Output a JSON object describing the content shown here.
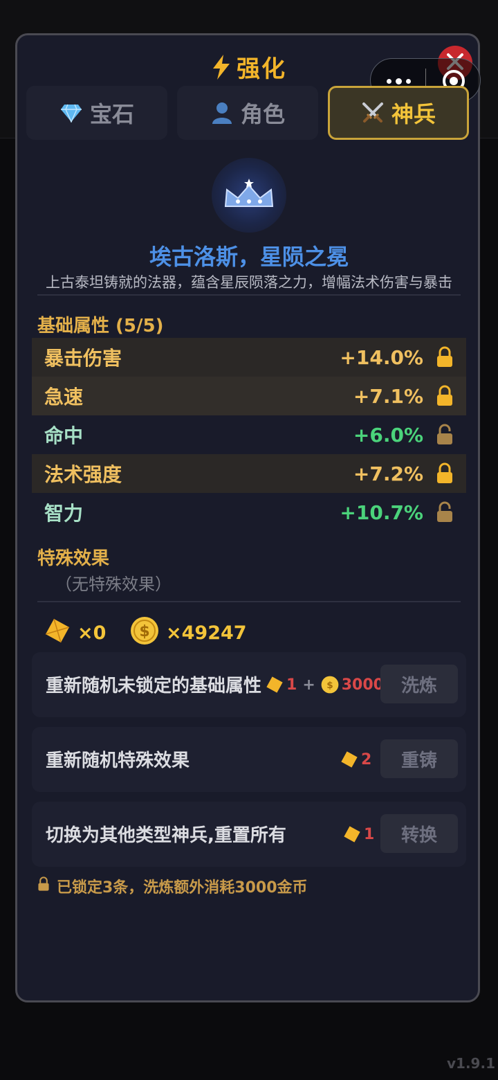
{
  "title": "强化",
  "tabs": [
    {
      "label": "宝石",
      "icon": "gem-icon",
      "active": false
    },
    {
      "label": "角色",
      "icon": "person-icon",
      "active": false
    },
    {
      "label": "神兵",
      "icon": "crossed-swords-icon",
      "active": true
    }
  ],
  "item": {
    "name": "埃古洛斯，星陨之冕",
    "description": "上古泰坦铸就的法器，蕴含星辰陨落之力，增幅法术伤害与暴击",
    "icon": "crown-icon"
  },
  "base_attributes": {
    "heading": "基础属性 (5/5)",
    "rows": [
      {
        "name": "暴击伤害",
        "value": "+14.0%",
        "locked": true
      },
      {
        "name": "急速",
        "value": "+7.1%",
        "locked": true
      },
      {
        "name": "命中",
        "value": "+6.0%",
        "locked": false
      },
      {
        "name": "法术强度",
        "value": "+7.2%",
        "locked": true
      },
      {
        "name": "智力",
        "value": "+10.7%",
        "locked": false
      }
    ]
  },
  "special": {
    "heading": "特殊效果",
    "empty_text": "（无特殊效果）"
  },
  "currency": {
    "shards": "×0",
    "gold": "×49247"
  },
  "actions": [
    {
      "label": "重新随机未锁定的基础属性",
      "cost_shards": "1",
      "cost_gold": "3000",
      "button": "洗炼"
    },
    {
      "label": "重新随机特殊效果",
      "cost_shards": "2",
      "button": "重铸"
    },
    {
      "label": "切换为其他类型神兵,重置所有",
      "cost_shards": "1",
      "button": "转换"
    }
  ],
  "footnote": "已锁定3条，洗炼额外消耗3000金币",
  "version": "v1.9.1",
  "colors": {
    "accent_gold": "#f3c43a",
    "item_name_blue": "#4d90e6",
    "value_green": "#4bd37b",
    "cost_red": "#d94848",
    "close_red": "#c8282e"
  }
}
